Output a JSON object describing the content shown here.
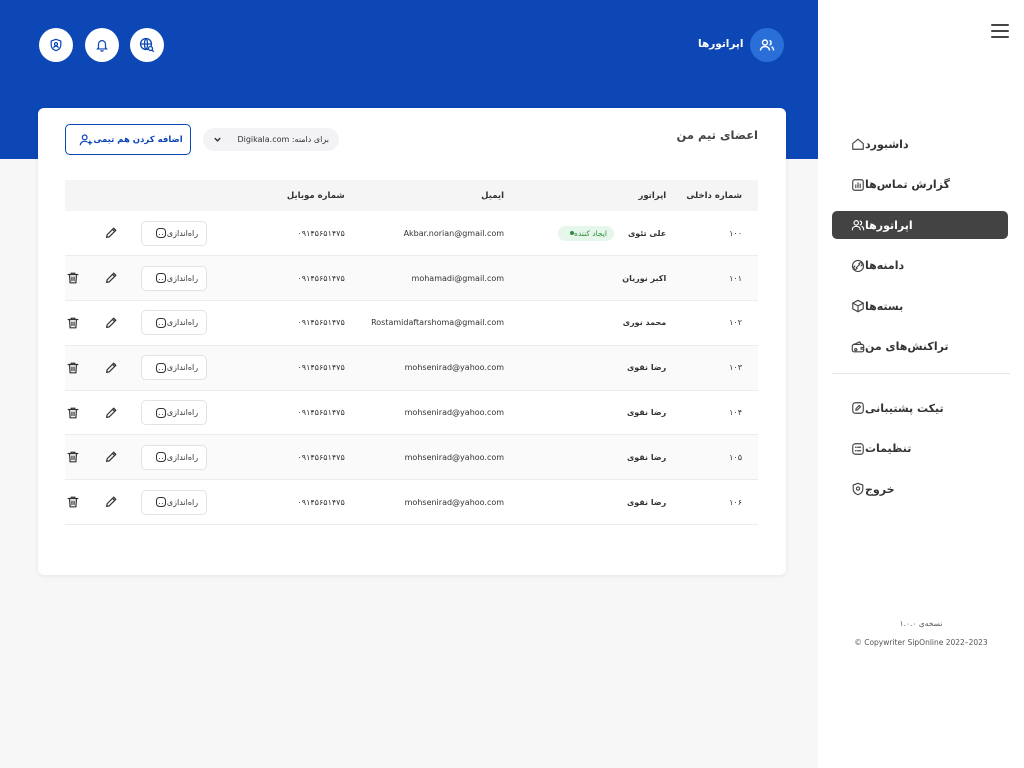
{
  "header": {
    "title": "اپراتورها",
    "icons": [
      "user-group-icon",
      "globe-search-icon",
      "bell-icon",
      "shield-user-icon"
    ]
  },
  "sidebar": {
    "items": [
      {
        "label": "داشبورد",
        "icon": "home-icon",
        "active": false
      },
      {
        "label": "گزارش تماس‌ها",
        "icon": "chart-icon",
        "active": false
      },
      {
        "label": "اپراتورها",
        "icon": "user-group-icon",
        "active": true
      },
      {
        "label": "دامنه‌ها",
        "icon": "link-icon",
        "active": false
      },
      {
        "label": "بسته‌ها",
        "icon": "box-icon",
        "active": false
      },
      {
        "label": "تراکنش‌های من",
        "icon": "wallet-icon",
        "active": false
      },
      {
        "label": "تیکت پشتیبانی",
        "icon": "pencil-square-icon",
        "active": false
      },
      {
        "label": "تنظیمات",
        "icon": "settings-list-icon",
        "active": false
      },
      {
        "label": "خروج",
        "icon": "shield-exit-icon",
        "active": false
      }
    ],
    "version": "نسخه‌ی ۱.۰.۰",
    "copyright": "© Copywriter SipOnline 2022–2023"
  },
  "card": {
    "title": "اعضای تیم من",
    "domain_label": "برای دامنه: Digikala.com",
    "add_button": "اضافه کردن هم تیمی"
  },
  "table": {
    "headers": {
      "ext": "شماره داخلی",
      "operator": "اپراتور",
      "email": "ایمیل",
      "mobile": "شماره موبایل"
    },
    "setup_label": "راه‌اندازی",
    "creator_badge": "ایجاد کننده",
    "rows": [
      {
        "ext": "۱۰۰",
        "name": "علی تئوی",
        "email": "Akbar.norian@gmail.com",
        "mobile": "۰۹۱۴۵۶۵۱۴۷۵",
        "creator": true
      },
      {
        "ext": "۱۰۱",
        "name": "اکبر نوریان",
        "email": "mohamadi@gmail.com",
        "mobile": "۰۹۱۴۵۶۵۱۴۷۵",
        "creator": false
      },
      {
        "ext": "۱۰۲",
        "name": "محمد نوری",
        "email": "Rostamidaftarshoma@gmail.com",
        "mobile": "۰۹۱۴۵۶۵۱۴۷۵",
        "creator": false
      },
      {
        "ext": "۱۰۳",
        "name": "رضا نقوی",
        "email": "mohsenirad@yahoo.com",
        "mobile": "۰۹۱۴۵۶۵۱۴۷۵",
        "creator": false
      },
      {
        "ext": "۱۰۴",
        "name": "رضا نقوی",
        "email": "mohsenirad@yahoo.com",
        "mobile": "۰۹۱۴۵۶۵۱۴۷۵",
        "creator": false
      },
      {
        "ext": "۱۰۵",
        "name": "رضا نقوی",
        "email": "mohsenirad@yahoo.com",
        "mobile": "۰۹۱۴۵۶۵۱۴۷۵",
        "creator": false
      },
      {
        "ext": "۱۰۶",
        "name": "رضا نقوی",
        "email": "mohsenirad@yahoo.com",
        "mobile": "۰۹۱۴۵۶۵۱۴۷۵",
        "creator": false
      }
    ]
  },
  "colors": {
    "primary": "#0d46b5",
    "active_nav": "#434343",
    "badge_bg": "#e6f6ea",
    "badge_text": "#2e8b3e"
  }
}
